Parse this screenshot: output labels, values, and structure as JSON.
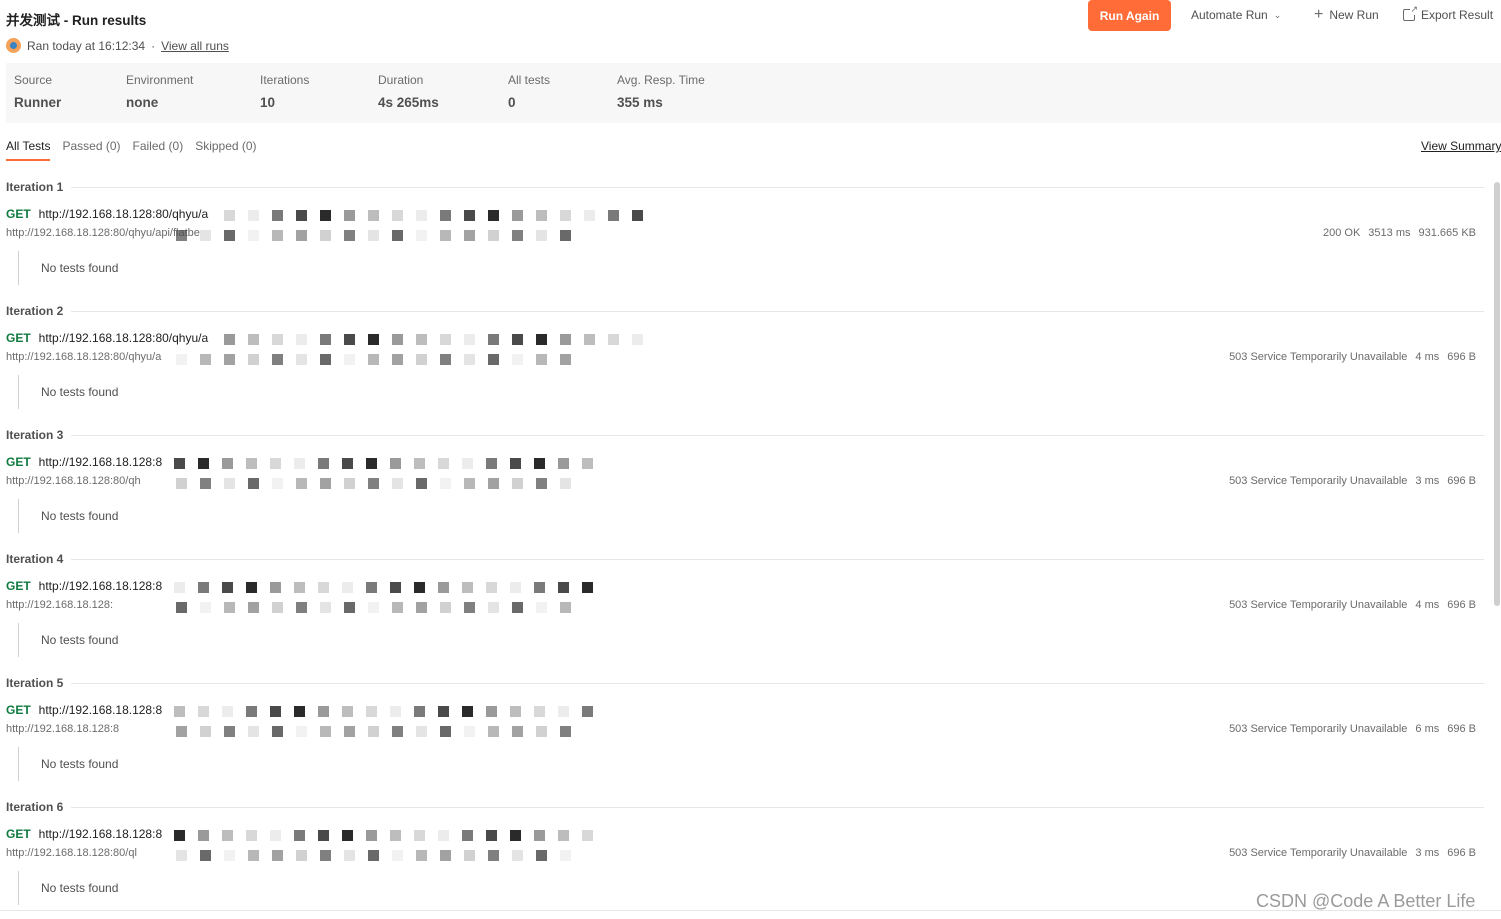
{
  "header": {
    "title": "并发测试 - Run results",
    "ran_text": "Ran today at 16:12:34",
    "separator": "·",
    "view_all_runs": "View all runs",
    "run_again": "Run Again",
    "automate_run": "Automate Run",
    "new_run": "New Run",
    "export_results": "Export Result"
  },
  "summary": {
    "source": {
      "label": "Source",
      "value": "Runner"
    },
    "environment": {
      "label": "Environment",
      "value": "none"
    },
    "iterations": {
      "label": "Iterations",
      "value": "10"
    },
    "duration": {
      "label": "Duration",
      "value": "4s 265ms"
    },
    "all_tests": {
      "label": "All tests",
      "value": "0"
    },
    "avg_resp": {
      "label": "Avg. Resp. Time",
      "value": "355 ms"
    }
  },
  "tabs": [
    "All Tests",
    "Passed (0)",
    "Failed (0)",
    "Skipped (0)"
  ],
  "view_summary": "View Summary",
  "iterations": [
    {
      "name": "Iteration 1",
      "method": "GET",
      "url": "http://192.168.18.128:80/qhyu/a",
      "url_sub": "http://192.168.18.128:80/qhyu/api/flatbe",
      "status": "200 OK",
      "time": "3513 ms",
      "size": "931.665 KB",
      "tests": "No tests found"
    },
    {
      "name": "Iteration 2",
      "method": "GET",
      "url": "http://192.168.18.128:80/qhyu/a",
      "url_sub": "http://192.168.18.128:80/qhyu/a",
      "status": "503 Service Temporarily Unavailable",
      "time": "4 ms",
      "size": "696 B",
      "tests": "No tests found"
    },
    {
      "name": "Iteration 3",
      "method": "GET",
      "url": "http://192.168.18.128:8",
      "url_sub": "http://192.168.18.128:80/qh",
      "status": "503 Service Temporarily Unavailable",
      "time": "3 ms",
      "size": "696 B",
      "tests": "No tests found"
    },
    {
      "name": "Iteration 4",
      "method": "GET",
      "url": "http://192.168.18.128:8",
      "url_sub": "http://192.168.18.128:",
      "status": "503 Service Temporarily Unavailable",
      "time": "4 ms",
      "size": "696 B",
      "tests": "No tests found"
    },
    {
      "name": "Iteration 5",
      "method": "GET",
      "url": "http://192.168.18.128:8",
      "url_sub": "http://192.168.18.128:8",
      "status": "503 Service Temporarily Unavailable",
      "time": "6 ms",
      "size": "696 B",
      "tests": "No tests found"
    },
    {
      "name": "Iteration 6",
      "method": "GET",
      "url": "http://192.168.18.128:8",
      "url_sub": "http://192.168.18.128:80/ql",
      "status": "503 Service Temporarily Unavailable",
      "time": "3 ms",
      "size": "696 B",
      "tests": "No tests found"
    }
  ],
  "watermark": "CSDN @Code A Better Life",
  "colors": {
    "accent": "#ff6c37",
    "get_method": "#0f7b3f"
  },
  "icons": {
    "runner": "runner-avatar-icon",
    "chevron": "chevron-down-icon",
    "new_run": "plus-icon",
    "export": "export-icon"
  }
}
